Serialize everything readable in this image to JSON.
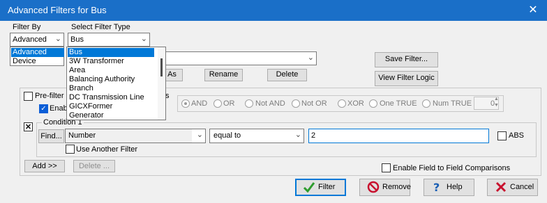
{
  "window": {
    "title": "Advanced Filters for Bus",
    "close_glyph": "✕"
  },
  "filter_by": {
    "label": "Filter By",
    "value": "Advanced",
    "options": [
      "Advanced",
      "Device"
    ]
  },
  "filter_type": {
    "label": "Select Filter Type",
    "value": "Bus",
    "options": [
      "Bus",
      "3W Transformer",
      "Area",
      "Balancing Authority",
      "Branch",
      "DC Transmission Line",
      "GICXFormer",
      "Generator"
    ]
  },
  "buttons": {
    "save_filter": "Save Filter...",
    "save_as_fragment": "As",
    "rename": "Rename",
    "delete": "Delete",
    "view_filter_logic": "View Filter Logic",
    "add": "Add >>",
    "delete_condition": "Delete ..."
  },
  "prefilter": {
    "label_start": "Pre-filter",
    "label_end": "s",
    "enable_label": "Enabl",
    "enable_checked": true
  },
  "logic": {
    "options": [
      "AND",
      "OR",
      "Not AND",
      "Not OR",
      "XOR",
      "One TRUE",
      "Num TRUE"
    ],
    "selected": "AND",
    "num_true_value": "0"
  },
  "condition": {
    "title": "Condition 1",
    "find_label": "Find...",
    "field": "Number",
    "operator": "equal to",
    "value": "2",
    "abs_label": "ABS",
    "use_another_filter_label": "Use Another Filter"
  },
  "field_to_field_label": "Enable Field to Field Comparisons",
  "footer": {
    "filter": "Filter",
    "remove": "Remove",
    "help": "Help",
    "cancel": "Cancel"
  },
  "colors": {
    "titlebar": "#1a6fc8",
    "selection": "#0078d7",
    "accent": "#0b5ed7"
  }
}
